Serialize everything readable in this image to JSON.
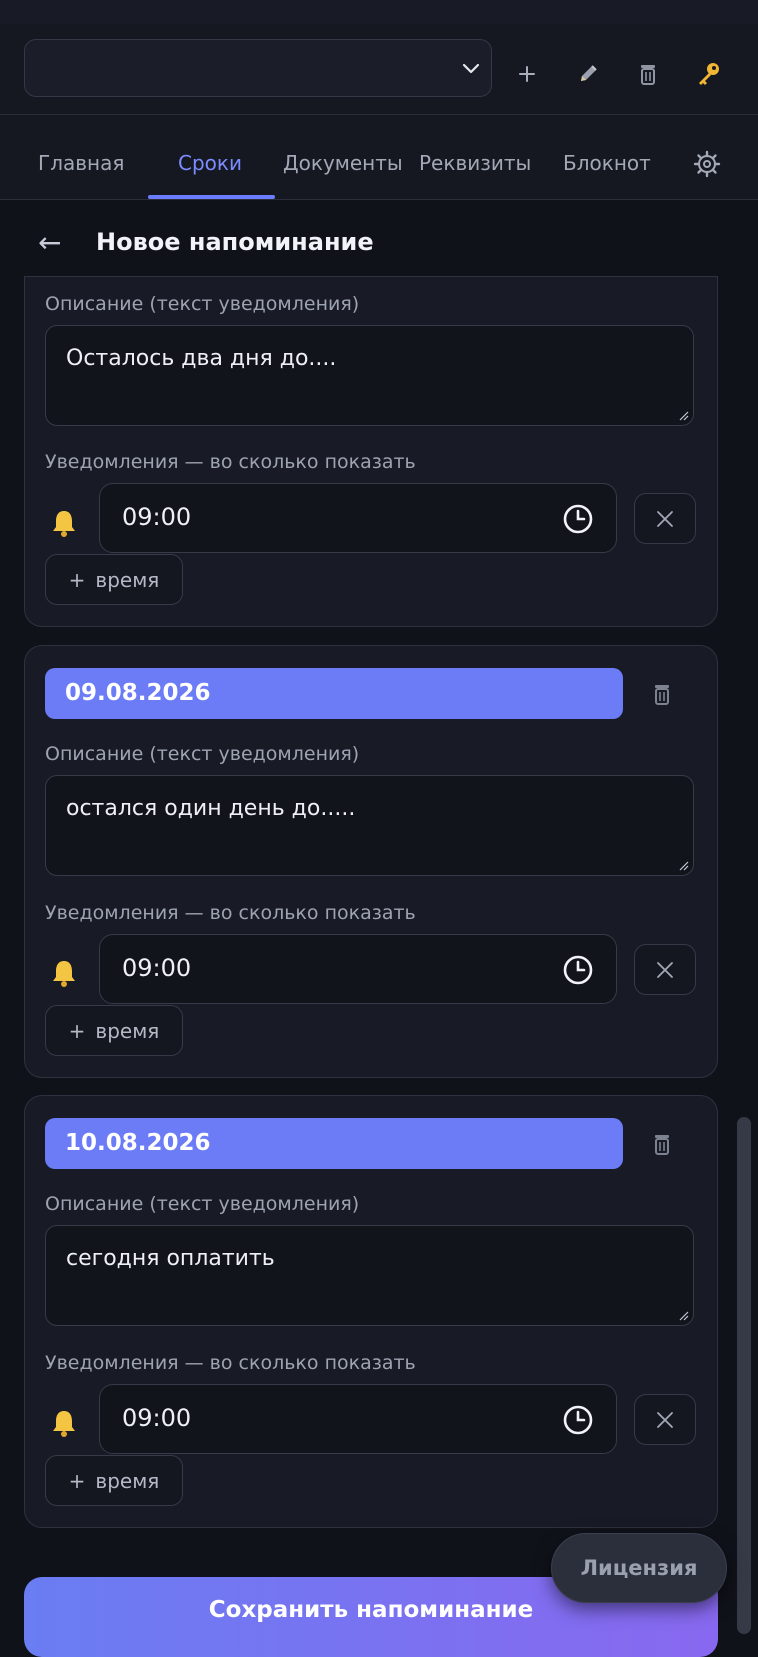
{
  "toolbar": {
    "select_value": "",
    "icons": [
      "chevron-down-icon",
      "plus-icon",
      "pencil-icon",
      "trash-icon",
      "key-icon"
    ]
  },
  "tabs": [
    {
      "label": "Главная",
      "active": false
    },
    {
      "label": "Сроки",
      "active": true
    },
    {
      "label": "Документы",
      "active": false
    },
    {
      "label": "Реквизиты",
      "active": false
    },
    {
      "label": "Блокнот",
      "active": false
    }
  ],
  "page": {
    "back_icon": "←",
    "title": "Новое напоминание"
  },
  "labels": {
    "description": "Описание (текст уведомления)",
    "notifications": "Уведомления — во сколько показать",
    "add_time_plus": "+",
    "add_time": "время"
  },
  "reminders": [
    {
      "date": "",
      "description": "Осталось два дня до....",
      "times": [
        "09:00"
      ]
    },
    {
      "date": "09.08.2026",
      "description": "остался один день до.....",
      "times": [
        "09:00"
      ]
    },
    {
      "date": "10.08.2026",
      "description": "сегодня оплатить",
      "times": [
        "09:00"
      ]
    }
  ],
  "license_button": "Лицензия",
  "save_button": "Сохранить напоминание",
  "colors": {
    "accent": "#6b7cf6",
    "bell": "#f4c542",
    "background": "#10121a"
  }
}
